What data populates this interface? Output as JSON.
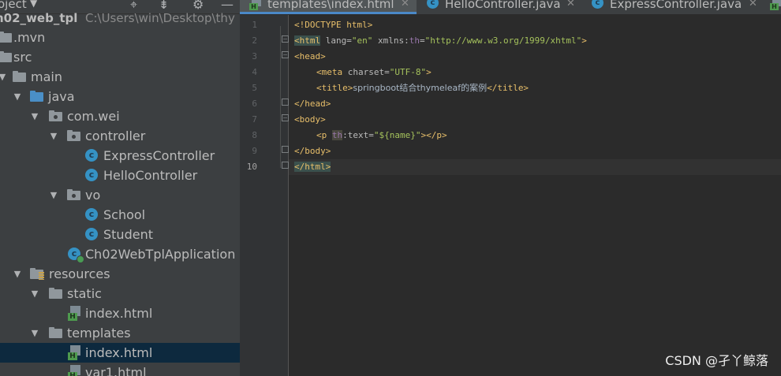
{
  "project_panel": {
    "title": "oject",
    "root": {
      "name": "h02_web_tpl",
      "path": "C:\\Users\\win\\Desktop\\thy"
    },
    "items": [
      {
        "label": ".mvn",
        "type": "folder"
      },
      {
        "label": "src",
        "type": "folder"
      },
      {
        "label": "main",
        "type": "folder"
      },
      {
        "label": "java",
        "type": "source-folder"
      },
      {
        "label": "com.wei",
        "type": "package"
      },
      {
        "label": "controller",
        "type": "package"
      },
      {
        "label": "ExpressController",
        "type": "class"
      },
      {
        "label": "HelloController",
        "type": "class"
      },
      {
        "label": "vo",
        "type": "package"
      },
      {
        "label": "School",
        "type": "class"
      },
      {
        "label": "Student",
        "type": "class"
      },
      {
        "label": "Ch02WebTplApplication",
        "type": "spring-boot-class"
      },
      {
        "label": "resources",
        "type": "resources-folder"
      },
      {
        "label": "static",
        "type": "folder"
      },
      {
        "label": "index.html",
        "type": "html-file"
      },
      {
        "label": "templates",
        "type": "folder"
      },
      {
        "label": "index.html",
        "type": "html-file",
        "selected": true
      },
      {
        "label": "var1.html",
        "type": "html-file"
      }
    ]
  },
  "editor": {
    "tabs": [
      {
        "label": "templates\\index.html",
        "icon": "html-file-icon",
        "active": true
      },
      {
        "label": "HelloController.java",
        "icon": "java-class-icon"
      },
      {
        "label": "ExpressController.java",
        "icon": "java-class-icon"
      }
    ],
    "line_numbers": [
      "1",
      "2",
      "3",
      "4",
      "5",
      "6",
      "7",
      "8",
      "9",
      "10"
    ],
    "current_line": "10",
    "code": {
      "l1_text": "<!DOCTYPE html>",
      "l2_open": "<html",
      "l2_attr1": " lang=",
      "l2_val1": "\"en\"",
      "l2_attr2": " xmlns:",
      "l2_ns": "th",
      "l2_eq": "=",
      "l2_val2": "\"http://www.w3.org/1999/xhtml\"",
      "l2_close": ">",
      "l3_tag": "<head>",
      "l4_open": "<meta",
      "l4_attr": " charset=",
      "l4_val": "\"UTF-8\"",
      "l4_close": ">",
      "l5_open": "<title>",
      "l5_text": "springboot结合thymeleaf的案例",
      "l5_close": "</title>",
      "l6_tag": "</head>",
      "l7_tag": "<body>",
      "l8_open": "<p ",
      "l8_ns": "th",
      "l8_attr": ":text=",
      "l8_val": "\"${name}\"",
      "l8_close": "></p>",
      "l9_tag": "</body>",
      "l10_tag": "</html>"
    }
  },
  "watermark": "CSDN @孑丫鲸落",
  "colors": {
    "tag": "#e8bf6a",
    "attribute": "#bababa",
    "value": "#a5c25c",
    "namespace": "#9876aa",
    "selection": "#0d293e",
    "active_tab_underline": "#4a88c7"
  }
}
